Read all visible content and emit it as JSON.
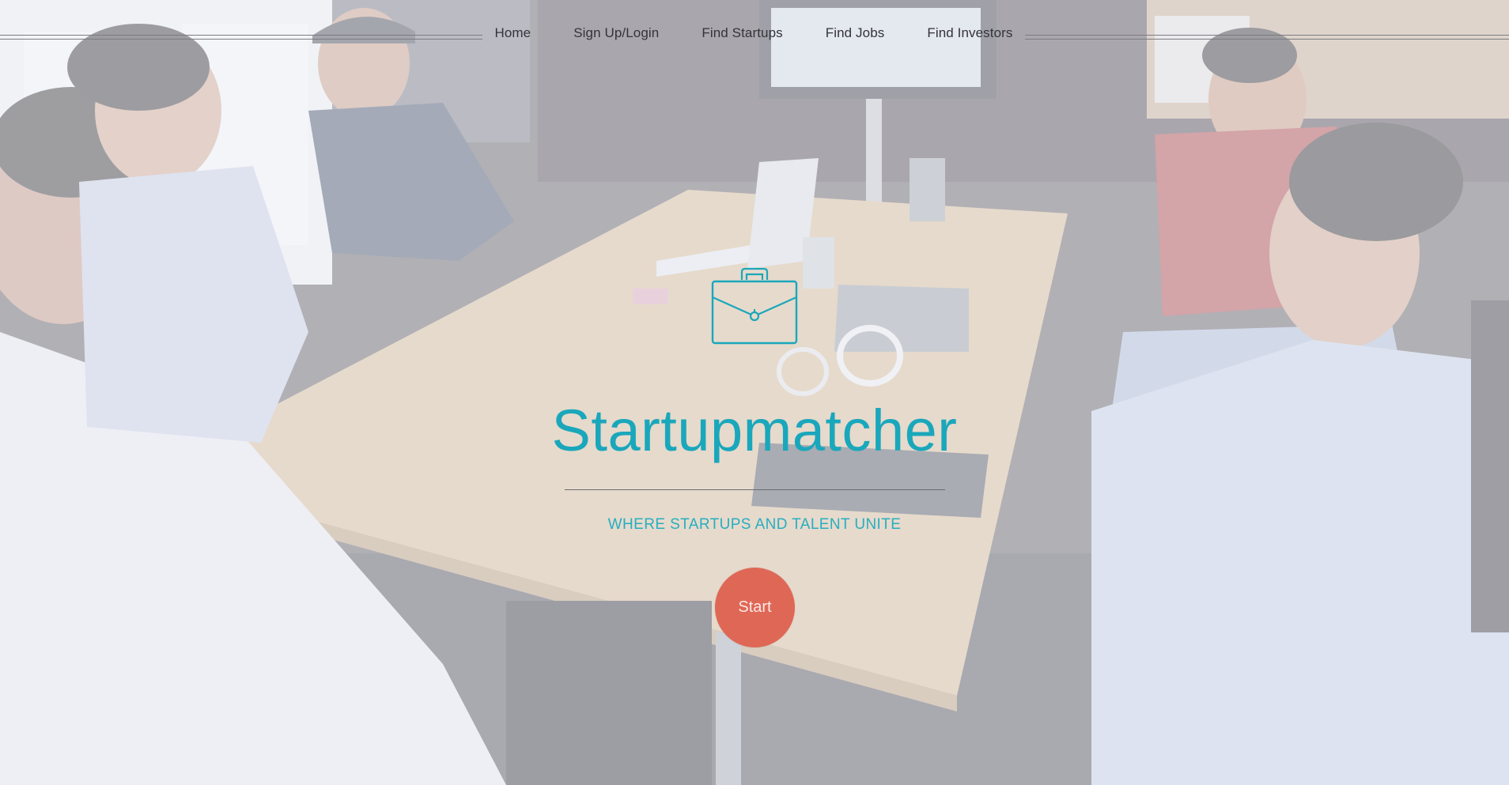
{
  "nav": {
    "items": [
      {
        "label": "Home"
      },
      {
        "label": "Sign Up/Login"
      },
      {
        "label": "Find Startups"
      },
      {
        "label": "Find Jobs"
      },
      {
        "label": "Find Investors"
      }
    ]
  },
  "hero": {
    "icon": "briefcase-icon",
    "title": "Startupmatcher",
    "tagline": "WHERE STARTUPS AND TALENT UNITE",
    "start_label": "Start"
  },
  "colors": {
    "accent": "#1aa7bb",
    "button": "#df6756",
    "nav_text": "#333338"
  }
}
